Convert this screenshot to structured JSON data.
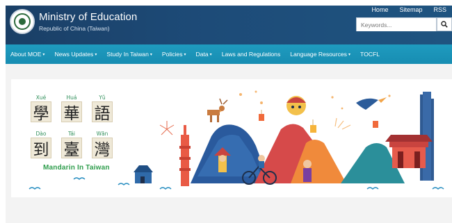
{
  "header": {
    "title": "Ministry of Education",
    "subtitle": "Republic of China (Taiwan)",
    "top_links": [
      "Home",
      "Sitemap",
      "RSS"
    ],
    "search": {
      "placeholder": "Keywords..."
    }
  },
  "nav": {
    "items": [
      {
        "label": "About MOE",
        "dropdown": true
      },
      {
        "label": "News Updates",
        "dropdown": true
      },
      {
        "label": "Study In Taiwan",
        "dropdown": true
      },
      {
        "label": "Policies",
        "dropdown": true
      },
      {
        "label": "Data",
        "dropdown": true
      },
      {
        "label": "Laws and Regulations",
        "dropdown": false
      },
      {
        "label": "Language Resources",
        "dropdown": true
      },
      {
        "label": "TOCFL",
        "dropdown": false
      }
    ]
  },
  "banner": {
    "row1": [
      {
        "char": "學",
        "pinyin": "Xué"
      },
      {
        "char": "華",
        "pinyin": "Huá"
      },
      {
        "char": "語",
        "pinyin": "Yǔ"
      }
    ],
    "row2": [
      {
        "char": "到",
        "pinyin": "Dào"
      },
      {
        "char": "臺",
        "pinyin": "Tái"
      },
      {
        "char": "灣",
        "pinyin": "Wān"
      }
    ],
    "tagline": "Mandarin In Taiwan"
  },
  "colors": {
    "header_bg": "#1d4b78",
    "nav_bg": "#1a94b9",
    "tagline": "#2e9d4c"
  }
}
